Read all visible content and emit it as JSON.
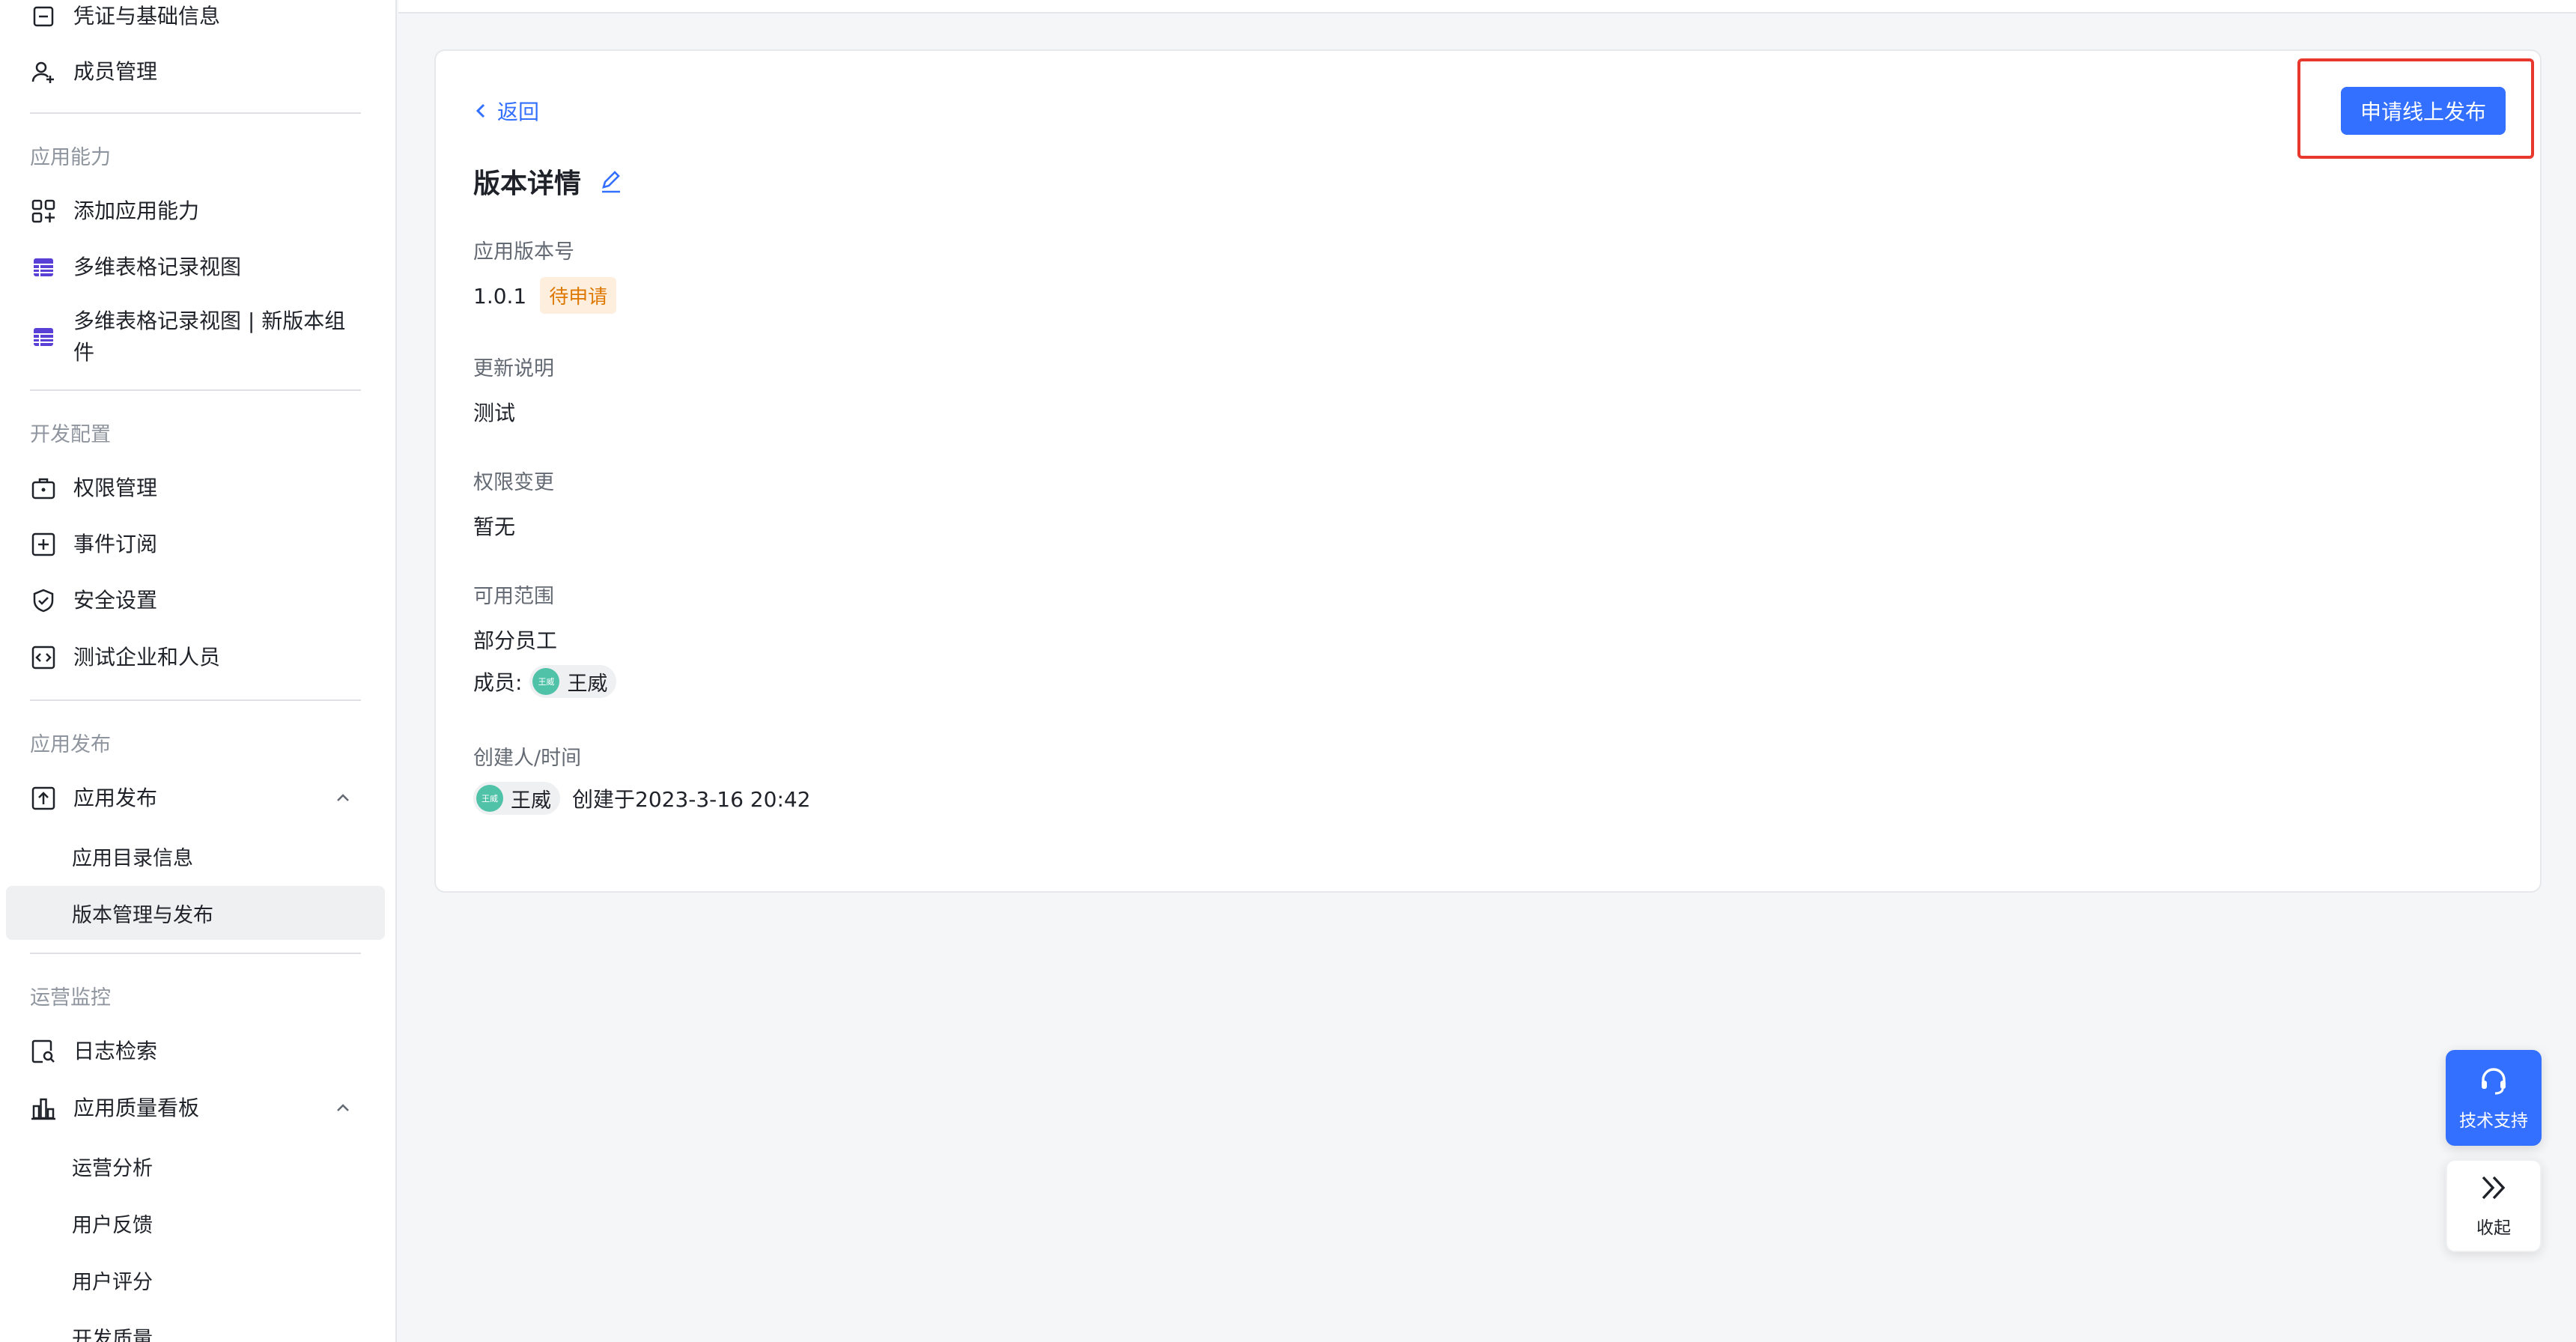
{
  "sidebar": {
    "top_cut_item": "凭证与基础信息",
    "member_management": "成员管理",
    "sections": {
      "capabilities": "应用能力",
      "dev_config": "开发配置",
      "publish": "应用发布",
      "ops": "运营监控"
    },
    "items": {
      "add_capability": "添加应用能力",
      "bitable_view": "多维表格记录视图",
      "bitable_view_new": "多维表格记录视图 | 新版本组件",
      "permissions": "权限管理",
      "events": "事件订阅",
      "security": "安全设置",
      "test_org": "测试企业和人员",
      "app_publish": "应用发布",
      "directory_info": "应用目录信息",
      "version_publish": "版本管理与发布",
      "log_search": "日志检索",
      "quality_board": "应用质量看板",
      "ops_analysis": "运营分析",
      "feedback": "用户反馈",
      "rating": "用户评分",
      "dev_quality": "开发质量"
    }
  },
  "detail": {
    "back": "返回",
    "title": "版本详情",
    "version_label": "应用版本号",
    "version_value": "1.0.1",
    "status": "待申请",
    "notes_label": "更新说明",
    "notes_value": "测试",
    "perm_label": "权限变更",
    "perm_value": "暂无",
    "scope_label": "可用范围",
    "scope_value": "部分员工",
    "members_prefix": "成员:",
    "member_name": "王威",
    "avatar_text": "王威",
    "creator_label": "创建人/时间",
    "creator_name": "王威",
    "created_at": "创建于2023-3-16 20:42",
    "publish_button": "申请线上发布"
  },
  "floating": {
    "support": "技术支持",
    "collapse": "收起"
  },
  "colors": {
    "accent": "#3370ff",
    "pending_bg": "#fdeede",
    "pending_text": "#de7802",
    "highlight": "#e8382e",
    "avatar": "#4fc2a8",
    "bitable_icon": "#5a3fd6"
  },
  "icons": {
    "member_management": "user-plus-icon",
    "add_capability": "grid-plus-icon",
    "bitable_view": "table-icon",
    "permissions": "briefcase-lock-icon",
    "events": "square-plus-icon",
    "security": "shield-check-icon",
    "test_org": "code-box-icon",
    "app_publish": "upload-box-icon",
    "log_search": "doc-search-icon",
    "quality_board": "bar-chart-icon"
  }
}
